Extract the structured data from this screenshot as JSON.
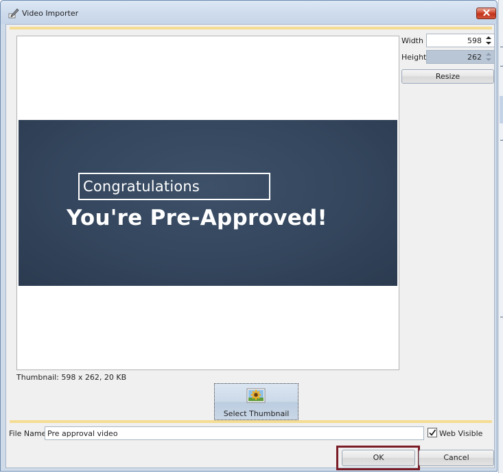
{
  "window": {
    "title": "Video Importer"
  },
  "dimensions": {
    "width_label": "Width",
    "width_value": "598",
    "height_label": "Height",
    "height_value": "262",
    "resize_label": "Resize"
  },
  "preview": {
    "line1": "Congratulations",
    "line2": "You're Pre-Approved!",
    "thumbnail_info": "Thumbnail: 598 x 262, 20 KB"
  },
  "select_thumbnail": {
    "label": "Select Thumbnail",
    "icon": "image-icon"
  },
  "file": {
    "label": "File Name",
    "value": "Pre approval video",
    "web_visible_label": "Web Visible",
    "web_visible_checked": true
  },
  "buttons": {
    "ok": "OK",
    "cancel": "Cancel"
  },
  "colors": {
    "title_bar": "#cfdbe9",
    "close_button": "#d2492f",
    "thumbnail_bg": "#34465d",
    "highlight_border": "#7a1c26",
    "panel_trim": "#f5dc93"
  }
}
